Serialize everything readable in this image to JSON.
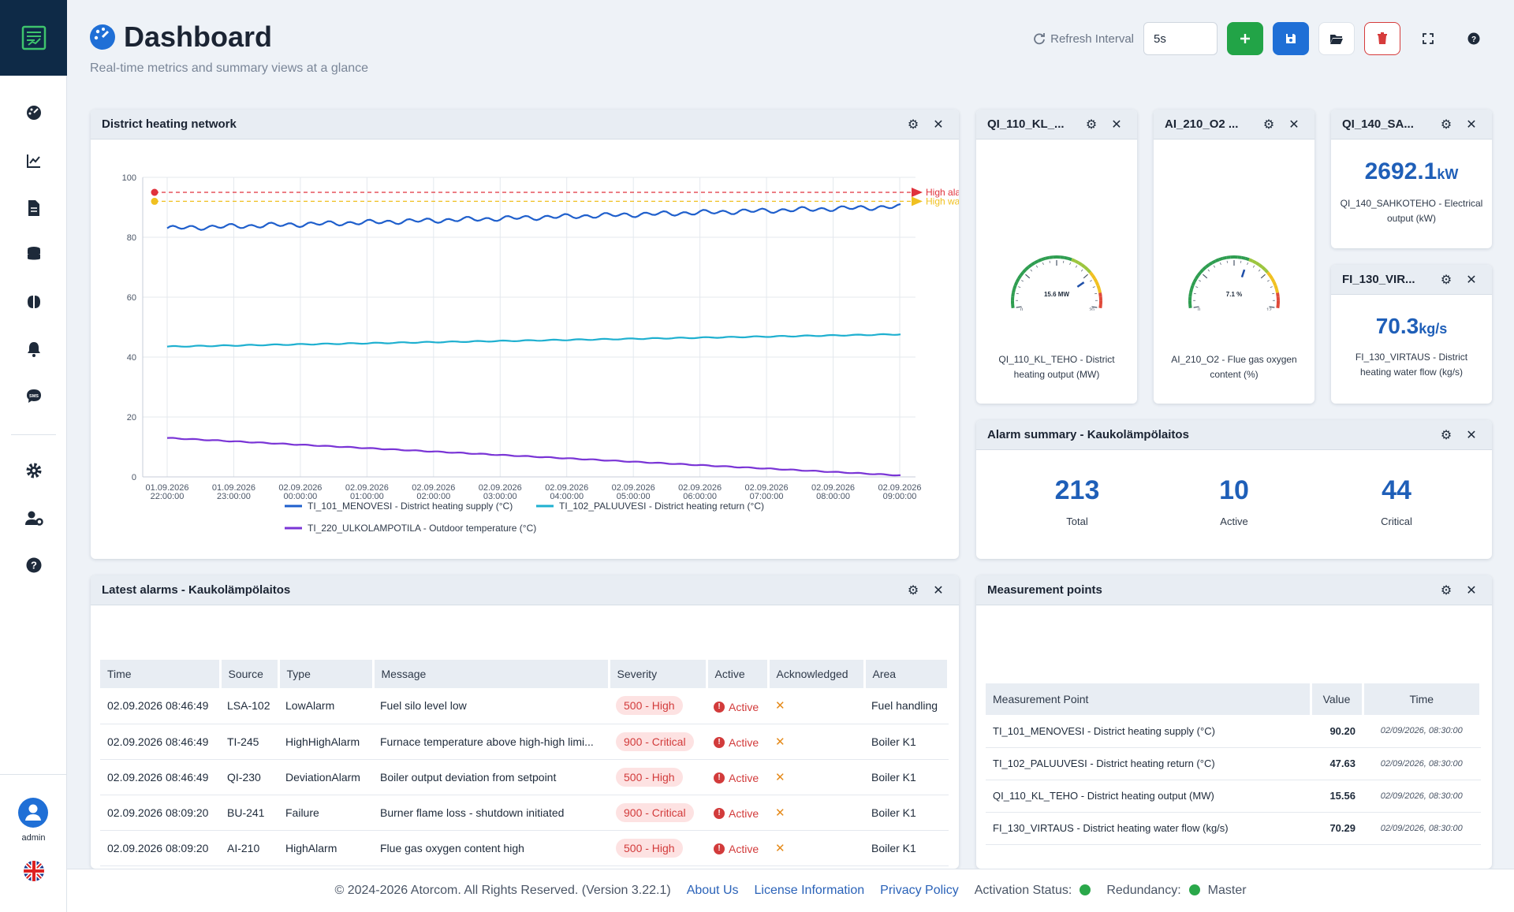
{
  "sidebar": {
    "user_label": "admin",
    "nav": [
      "dashboard-icon",
      "trend-icon",
      "report-icon",
      "database-icon",
      "brain-icon",
      "bell-icon",
      "sms-icon",
      "gear-icon",
      "user-settings-icon",
      "help-icon"
    ]
  },
  "header": {
    "title": "Dashboard",
    "subtitle": "Real-time metrics and summary views at a glance",
    "refresh_label": "Refresh Interval",
    "refresh_value": "5s"
  },
  "colors": {
    "accent": "#1f6fd6",
    "add": "#22a447",
    "delete": "#d63b3b",
    "value": "#1f5fb8"
  },
  "widgets": {
    "heating": {
      "title": "District heating network"
    },
    "g1": {
      "title": "QI_110_KL_...",
      "gauge_text": "15.6 MW",
      "min": "0",
      "max": "20",
      "value": 15.6,
      "caption": "QI_110_KL_TEHO - District heating output (MW)"
    },
    "g2": {
      "title": "AI_210_O2 ...",
      "gauge_text": "7.1 %",
      "min": "0",
      "max": "12",
      "value": 7.1,
      "caption": "AI_210_O2 - Flue gas oxygen content (%)"
    },
    "v1": {
      "title": "QI_140_SA...",
      "value": "2692.1",
      "unit": "kW",
      "caption": "QI_140_SAHKOTEHO - Electrical output (kW)"
    },
    "v2": {
      "title": "FI_130_VIR...",
      "value": "70.3",
      "unit": "kg/s",
      "caption": "FI_130_VIRTAUS - District heating water flow (kg/s)"
    },
    "summary": {
      "title": "Alarm summary - Kaukolämpölaitos",
      "total": "213",
      "total_label": "Total",
      "active": "10",
      "active_label": "Active",
      "critical": "44",
      "critical_label": "Critical"
    },
    "alarms": {
      "title": "Latest alarms - Kaukolämpölaitos",
      "headers": [
        "Time",
        "Source",
        "Type",
        "Message",
        "Severity",
        "Active",
        "Acknowledged",
        "Area"
      ],
      "rows": [
        {
          "time": "02.09.2026 08:46:49",
          "source": "LSA-102",
          "type": "LowAlarm",
          "message": "Fuel silo level low",
          "severity": "500 - High",
          "active": "Active",
          "ack": "✕",
          "area": "Fuel handling"
        },
        {
          "time": "02.09.2026 08:46:49",
          "source": "TI-245",
          "type": "HighHighAlarm",
          "message": "Furnace temperature above high-high limi...",
          "severity": "900 - Critical",
          "active": "Active",
          "ack": "✕",
          "area": "Boiler K1"
        },
        {
          "time": "02.09.2026 08:46:49",
          "source": "QI-230",
          "type": "DeviationAlarm",
          "message": "Boiler output deviation from setpoint",
          "severity": "500 - High",
          "active": "Active",
          "ack": "✕",
          "area": "Boiler K1"
        },
        {
          "time": "02.09.2026 08:09:20",
          "source": "BU-241",
          "type": "Failure",
          "message": "Burner flame loss - shutdown initiated",
          "severity": "900 - Critical",
          "active": "Active",
          "ack": "✕",
          "area": "Boiler K1"
        },
        {
          "time": "02.09.2026 08:09:20",
          "source": "AI-210",
          "type": "HighAlarm",
          "message": "Flue gas oxygen content high",
          "severity": "500 - High",
          "active": "Active",
          "ack": "✕",
          "area": "Boiler K1"
        }
      ]
    },
    "points": {
      "title": "Measurement points",
      "headers": [
        "Measurement Point",
        "Value",
        "Time"
      ],
      "rows": [
        {
          "name": "TI_101_MENOVESI - District heating supply (°C)",
          "value": "90.20",
          "time": "02/09/2026, 08:30:00"
        },
        {
          "name": "TI_102_PALUUVESI - District heating return (°C)",
          "value": "47.63",
          "time": "02/09/2026, 08:30:00"
        },
        {
          "name": "QI_110_KL_TEHO - District heating output (MW)",
          "value": "15.56",
          "time": "02/09/2026, 08:30:00"
        },
        {
          "name": "FI_130_VIRTAUS - District heating water flow (kg/s)",
          "value": "70.29",
          "time": "02/09/2026, 08:30:00"
        }
      ]
    }
  },
  "chart_data": {
    "type": "line",
    "x_ticks": [
      [
        "01.09.2026",
        "22:00:00"
      ],
      [
        "01.09.2026",
        "23:00:00"
      ],
      [
        "02.09.2026",
        "00:00:00"
      ],
      [
        "02.09.2026",
        "01:00:00"
      ],
      [
        "02.09.2026",
        "02:00:00"
      ],
      [
        "02.09.2026",
        "03:00:00"
      ],
      [
        "02.09.2026",
        "04:00:00"
      ],
      [
        "02.09.2026",
        "05:00:00"
      ],
      [
        "02.09.2026",
        "06:00:00"
      ],
      [
        "02.09.2026",
        "07:00:00"
      ],
      [
        "02.09.2026",
        "08:00:00"
      ],
      [
        "02.09.2026",
        "09:00:00"
      ]
    ],
    "ylim": [
      0,
      100
    ],
    "y_ticks": [
      0,
      20,
      40,
      60,
      80,
      100
    ],
    "series": [
      {
        "name": "TI_101_MENOVESI - District heating supply (°C)",
        "color": "#1f5fcc",
        "start": 83,
        "end": 90.2
      },
      {
        "name": "TI_102_PALUUVESI - District heating return (°C)",
        "color": "#1fb0d0",
        "start": 43.5,
        "end": 47.6
      },
      {
        "name": "TI_220_ULKOLAMPOTILA - Outdoor temperature (°C)",
        "color": "#7a35d6",
        "start": 13,
        "end": 0.5
      }
    ],
    "thresholds": [
      {
        "label": "High ala",
        "value": 95,
        "color": "#e0323c"
      },
      {
        "label": "High wa",
        "value": 92,
        "color": "#f0c020"
      }
    ],
    "grid": true,
    "legend": "bottom"
  },
  "footer": {
    "copyright": "© 2024-2026 Atorcom. All Rights Reserved. (Version 3.22.1)",
    "about": "About Us",
    "license": "License Information",
    "privacy": "Privacy Policy",
    "activation": "Activation Status:",
    "redundancy": "Redundancy:",
    "redundancy_value": "Master"
  }
}
